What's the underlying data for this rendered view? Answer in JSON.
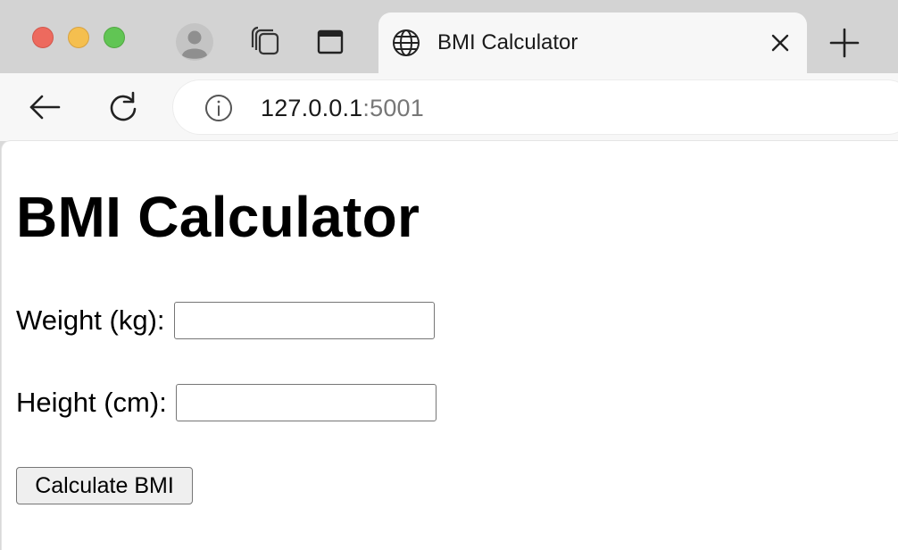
{
  "browser": {
    "tab": {
      "title": "BMI Calculator"
    },
    "address_bar": {
      "host": "127.0.0.1",
      "port": ":5001"
    }
  },
  "page": {
    "heading": "BMI Calculator",
    "form": {
      "weight_label": "Weight (kg):",
      "weight_value": "",
      "height_label": "Height (cm):",
      "height_value": "",
      "submit_label": "Calculate BMI"
    }
  },
  "icons": {
    "profile": "profile-icon",
    "collections": "collections-icon",
    "tab_actions": "tab-actions-icon",
    "tab_favicon": "globe-icon",
    "tab_close": "close-icon",
    "new_tab": "plus-icon",
    "back": "back-arrow-icon",
    "reload": "reload-icon",
    "site_info": "info-icon"
  },
  "colors": {
    "close_dot": "#ed6a5e",
    "minimize_dot": "#f5bf4f",
    "zoom_dot": "#61c554",
    "tab_bar": "#d3d3d3",
    "toolbar": "#f7f7f7",
    "url_port": "#777777"
  }
}
